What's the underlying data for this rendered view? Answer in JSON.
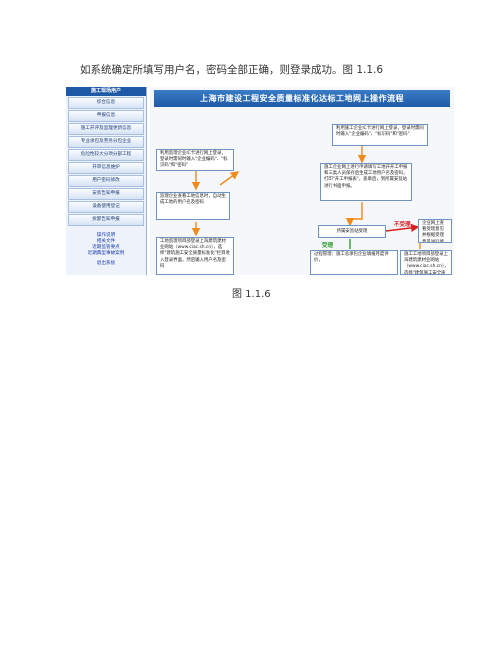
{
  "intro_text": "如系统确定所填写用户名，密码全部正确，则登录成功。图 1.1.6",
  "caption": "图 1.1.6",
  "colors": {
    "accent": "#1f5aa6",
    "reject": "#d62020",
    "approve": "#2e9a2e",
    "arrow": "#f08a1c"
  },
  "sidebar": {
    "title": "施工现场用户",
    "items": [
      "综合信息",
      "申报信息",
      "施工开评及监理更新信息",
      "专业承包及劳务分包企业",
      "危险性较大分项分部工程",
      "开审信息维护",
      "用户密码修改",
      "安装告知申报",
      "设备使用登记",
      "拆卸告知申报"
    ],
    "links": [
      "操作说明",
      "相关文件",
      "近期监管要点",
      "近期典型事故案例"
    ],
    "logout": "退出系统"
  },
  "flow": {
    "title": "上海市建设工程安全质量标准化达标工地网上操作流程",
    "box_login_right": "利用施工企业IC卡进行网上登录，登录时需同时输入\"企业编码\"、\"标识码\"和\"密码\"",
    "box_login_left": "利用监理企业IC卡进行网上登录，登录时需同时输入\"企业编码\"、\"标识码\"和\"密码\"",
    "box_apply": "施工企业网上进行申请填写工地开开工申报和三类人员保存后生成工地用户名及密码，打印\"开工申报表\"，盖章后，到所属安监站进行书面申报。",
    "box_supervisor_view": "监理企业查看工地信息时，自动生成工地的用户名及密码",
    "box_review": "所属安监站受理",
    "box_reject": "企业网上查看受理意见并根据受理意见进行修改",
    "box_left_bottom": "工地监理项目部登录上海建筑建材业网站（www.ciac.sh.cn），选择\"建筑施工安全质量标准化\"栏目进入登录界面，然后输入用户名及密码",
    "box_pass": "过程管理：施工总承包企业填报月度评价，",
    "box_right_bottom": "施工工地项目部登录上海建筑建材业网站（www.ciac.sh.cn），选择\"建筑施工安全质量标准化\"栏目进入登录界面",
    "label_reject": "不受理",
    "label_approve": "受理"
  }
}
